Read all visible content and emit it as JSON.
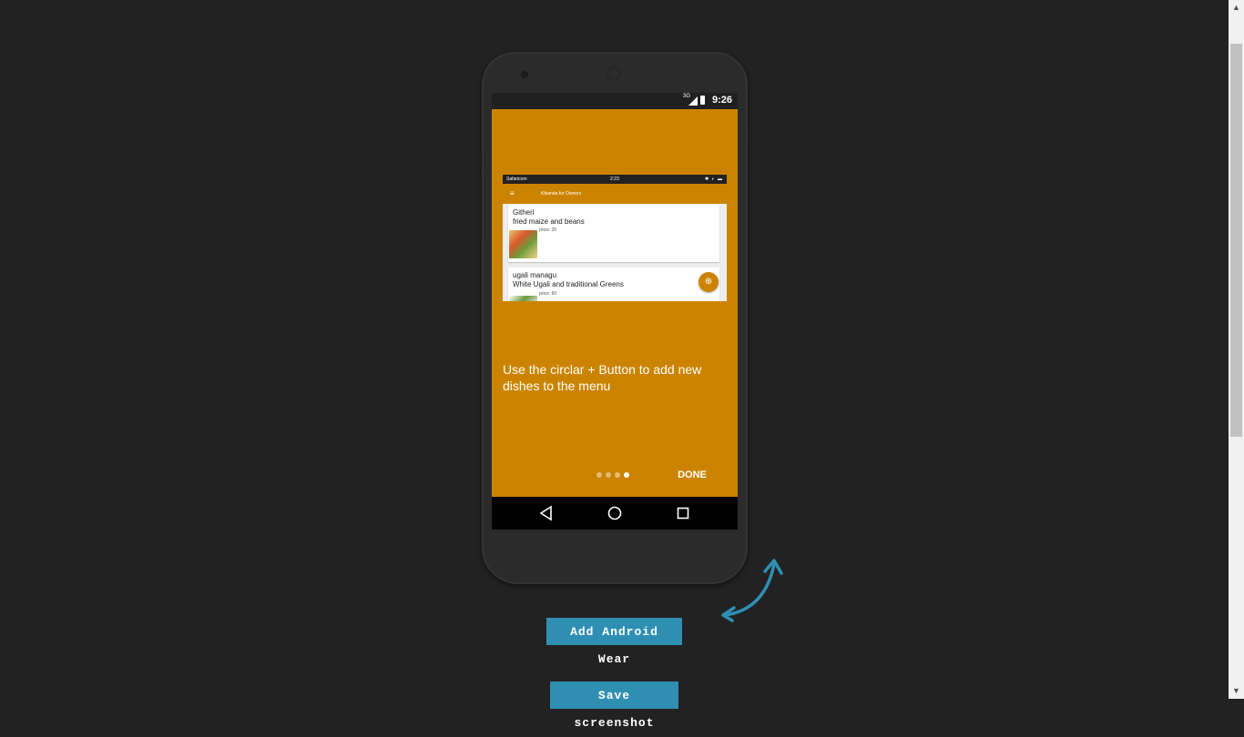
{
  "status_bar": {
    "network": "3G",
    "time": "9:26"
  },
  "inner_screenshot": {
    "carrier": "Safaricom",
    "time": "2:23",
    "app_title": "Kibanda for Owners",
    "dishes": [
      {
        "name": "Githeri",
        "description": "fried maize and beans",
        "price": "price: 30"
      },
      {
        "name": "ugali managu",
        "description": "White Ugali and traditional Greens",
        "price": "price: 60"
      }
    ]
  },
  "intro": {
    "text": "Use the circlar + Button to add new dishes to the menu",
    "page_count": 4,
    "current_page": 4,
    "done_label": "DONE"
  },
  "buttons": {
    "add_wear": "Add Android Wear",
    "save_screenshot": "Save screenshot"
  },
  "colors": {
    "accent": "#cc8400",
    "button": "#2e8fb3",
    "background": "#222222"
  },
  "icons": {
    "back": "back-triangle-icon",
    "home": "home-circle-icon",
    "recent": "recent-square-icon",
    "rotate": "rotate-arrow-icon"
  }
}
